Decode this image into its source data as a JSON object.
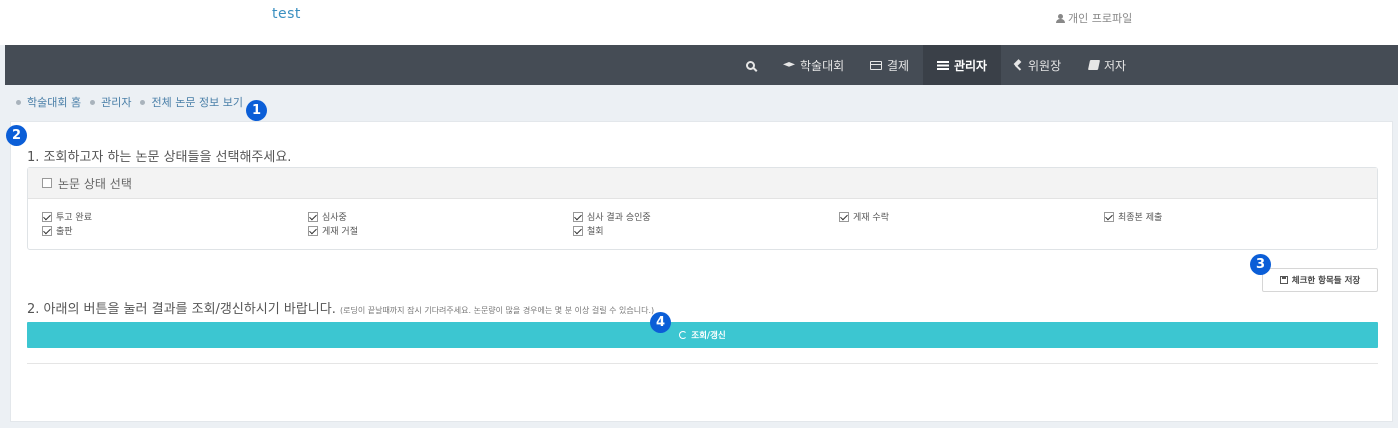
{
  "header": {
    "site_title": "test",
    "profile_link": "개인 프로파일"
  },
  "nav": {
    "items": [
      {
        "label": "",
        "icon": "search-icon"
      },
      {
        "label": "학술대회",
        "icon": "graduation-cap-icon"
      },
      {
        "label": "결제",
        "icon": "credit-card-icon"
      },
      {
        "label": "관리자",
        "icon": "list-icon",
        "active": true
      },
      {
        "label": "위원장",
        "icon": "gavel-icon"
      },
      {
        "label": "저자",
        "icon": "book-icon"
      }
    ]
  },
  "breadcrumb": [
    "학술대회 홈",
    "관리자",
    "전체 논문 정보 보기"
  ],
  "markers": [
    "1",
    "2",
    "3",
    "4"
  ],
  "step1": {
    "title": "1. 조회하고자 하는 논문 상태들을 선택해주세요.",
    "box_header": "논문 상태 선택",
    "options": [
      {
        "label": "투고 완료",
        "checked": true
      },
      {
        "label": "심사중",
        "checked": true
      },
      {
        "label": "심사 결과 승인중",
        "checked": true
      },
      {
        "label": "게재 수락",
        "checked": true
      },
      {
        "label": "최종본 제출",
        "checked": true
      },
      {
        "label": "출판",
        "checked": true
      },
      {
        "label": "게재 거절",
        "checked": true
      },
      {
        "label": "철회",
        "checked": true
      }
    ],
    "save_button": "체크한 항목들 저장"
  },
  "step2": {
    "title": "2. 아래의 버튼을 눌러 결과를 조회/갱신하시기 바랍니다.",
    "note": "(로딩이 끝날때까지 잠시 기다려주세요. 논문량이 많을 경우에는 몇 분 이상 걸릴 수 있습니다.)",
    "button": "조회/갱신"
  },
  "colors": {
    "navbar": "#454c55",
    "accent_button": "#3cc6d1",
    "marker": "#0b5ed7",
    "link": "#3a8fc0"
  }
}
